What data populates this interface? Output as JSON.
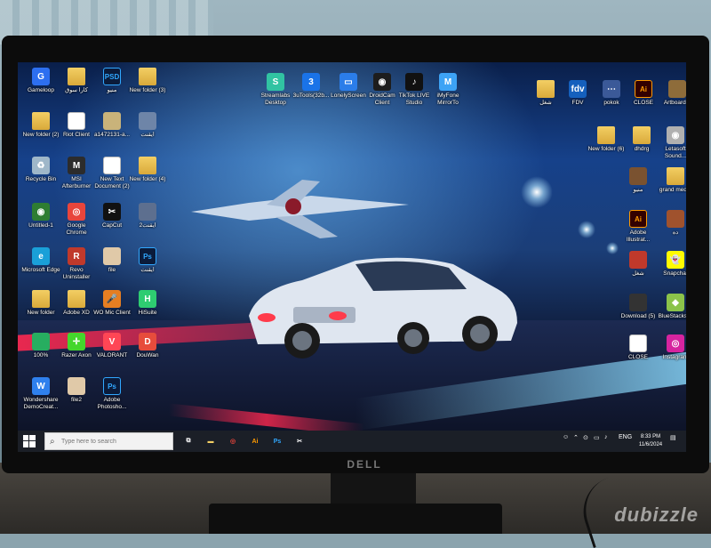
{
  "monitor": {
    "brand": "DELL"
  },
  "desktop": {
    "icons": [
      {
        "label": "Gameloop",
        "type": "app",
        "color": "#2d6ff0",
        "glyph": "G"
      },
      {
        "label": "كارا سوق",
        "type": "folder"
      },
      {
        "label": "منيو",
        "type": "ps",
        "glyph": "PSD"
      },
      {
        "label": "New folder (3)",
        "type": "folder"
      },
      {
        "label": "New folder (2)",
        "type": "folder"
      },
      {
        "label": "Riot Client",
        "type": "doc"
      },
      {
        "label": "a1472131-a...",
        "type": "app",
        "color": "#c9b37a",
        "glyph": ""
      },
      {
        "label": "ايقنت",
        "type": "app",
        "color": "#6e85a8",
        "glyph": ""
      },
      {
        "label": "Recycle Bin",
        "type": "app",
        "color": "#9fb7c9",
        "glyph": "♻"
      },
      {
        "label": "MSI Afterburner",
        "type": "app",
        "color": "#2c2c2c",
        "glyph": "M"
      },
      {
        "label": "New Text Document (2)",
        "type": "doc"
      },
      {
        "label": "New folder (4)",
        "type": "folder"
      },
      {
        "label": "Untitled-1",
        "type": "app",
        "color": "#2e7d32",
        "glyph": "◉"
      },
      {
        "label": "Google Chrome",
        "type": "app",
        "color": "#e8453c",
        "glyph": "◎"
      },
      {
        "label": "CapCut",
        "type": "app",
        "color": "#111111",
        "glyph": "✂"
      },
      {
        "label": "ايقنت2",
        "type": "app",
        "color": "#5d6f8f",
        "glyph": ""
      },
      {
        "label": "Microsoft Edge",
        "type": "app",
        "color": "#1aa0d8",
        "glyph": "e"
      },
      {
        "label": "Revo Uninstaller",
        "type": "app",
        "color": "#c0392b",
        "glyph": "R"
      },
      {
        "label": "file",
        "type": "app",
        "color": "#e0c9a8",
        "glyph": ""
      },
      {
        "label": "ايقنت",
        "type": "ps",
        "glyph": "Ps"
      },
      {
        "label": "New folder",
        "type": "folder"
      },
      {
        "label": "Adobe XD",
        "type": "folder"
      },
      {
        "label": "WO Mic Client",
        "type": "app",
        "color": "#e67e22",
        "glyph": "🎤"
      },
      {
        "label": "HiSuite",
        "type": "app",
        "color": "#2ecc71",
        "glyph": "H"
      },
      {
        "label": "100%",
        "type": "app",
        "color": "#27ae60",
        "glyph": ""
      },
      {
        "label": "Razer Axon",
        "type": "app",
        "color": "#44d62c",
        "glyph": "✛"
      },
      {
        "label": "VALORANT",
        "type": "app",
        "color": "#ff4655",
        "glyph": "V"
      },
      {
        "label": "DouWan",
        "type": "app",
        "color": "#e74c3c",
        "glyph": "D"
      },
      {
        "label": "Wondershare DemoCreat...",
        "type": "app",
        "color": "#2f80ed",
        "glyph": "W"
      },
      {
        "label": "file2",
        "type": "app",
        "color": "#e0c9a8",
        "glyph": ""
      },
      {
        "label": "Adobe Photosho...",
        "type": "ps",
        "glyph": "Ps"
      },
      {
        "label": "Streamlabs Desktop",
        "type": "app",
        "color": "#31c3a2",
        "glyph": "S"
      },
      {
        "label": "3uTools(32b...",
        "type": "app",
        "color": "#1a73e8",
        "glyph": "3"
      },
      {
        "label": "LonelyScreen",
        "type": "app",
        "color": "#2b7de9",
        "glyph": "▭"
      },
      {
        "label": "DroidCam Client",
        "type": "app",
        "color": "#1d1d1d",
        "glyph": "◉"
      },
      {
        "label": "TikTok LIVE Studio",
        "type": "app",
        "color": "#111111",
        "glyph": "♪"
      },
      {
        "label": "iMyFone MirrorTo",
        "type": "app",
        "color": "#3da3f5",
        "glyph": "M"
      },
      {
        "label": "شغل",
        "type": "folder"
      },
      {
        "label": "FDV",
        "type": "app",
        "color": "#1560bd",
        "glyph": "fdv"
      },
      {
        "label": "pokok",
        "type": "app",
        "color": "#3b5998",
        "glyph": "⋯"
      },
      {
        "label": "CLOSE",
        "type": "ai",
        "glyph": "Ai"
      },
      {
        "label": "Artboard 3",
        "type": "app",
        "color": "#8e6c3a",
        "glyph": ""
      },
      {
        "label": "New folder (6)",
        "type": "folder"
      },
      {
        "label": "dhdrg",
        "type": "folder"
      },
      {
        "label": "Letasoft Sound...",
        "type": "app",
        "color": "#b0b0b0",
        "glyph": "◉"
      },
      {
        "label": "منيو",
        "type": "app",
        "color": "#7a5230",
        "glyph": ""
      },
      {
        "label": "grand media",
        "type": "folder"
      },
      {
        "label": "Adobe Illustrat...",
        "type": "ai",
        "glyph": "Ai"
      },
      {
        "label": "ده",
        "type": "app",
        "color": "#a0522d",
        "glyph": ""
      },
      {
        "label": "شغل",
        "type": "app",
        "color": "#c0392b",
        "glyph": ""
      },
      {
        "label": "Snapchat",
        "type": "app",
        "color": "#fffc00",
        "glyph": "👻"
      },
      {
        "label": "Download (5)",
        "type": "app",
        "color": "#333333",
        "glyph": ""
      },
      {
        "label": "BlueStacks X",
        "type": "app",
        "color": "#8bc34a",
        "glyph": "◆"
      },
      {
        "label": "CLOSE",
        "type": "doc"
      },
      {
        "label": "Instagram",
        "type": "app",
        "color": "#d6249f",
        "glyph": "◎"
      }
    ]
  },
  "taskbar": {
    "search_placeholder": "Type here to search",
    "apps": [
      {
        "name": "task-view",
        "color": "#ffffff",
        "glyph": "⧉"
      },
      {
        "name": "file-explorer",
        "color": "#f3cf64",
        "glyph": "▬"
      },
      {
        "name": "chrome",
        "color": "#e8453c",
        "glyph": "◎"
      },
      {
        "name": "illustrator",
        "color": "#ff9a00",
        "glyph": "Ai"
      },
      {
        "name": "photoshop",
        "color": "#31a8ff",
        "glyph": "Ps"
      },
      {
        "name": "capcut",
        "color": "#ffffff",
        "glyph": "✂"
      }
    ],
    "language": "ENG",
    "time": "8:33 PM",
    "date": "11/6/2024"
  }
}
